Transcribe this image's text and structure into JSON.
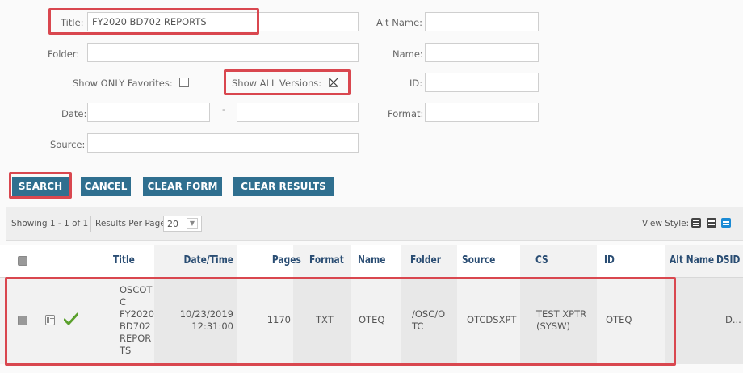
{
  "form": {
    "title_label": "Title:",
    "title_value": "FY2020 BD702 REPORTS",
    "folder_label": "Folder:",
    "folder_value": "",
    "show_favorites_label": "Show ONLY Favorites:",
    "show_all_versions_label": "Show ALL Versions:",
    "show_all_versions_checked": true,
    "date_label": "Date:",
    "date_separator": "-",
    "source_label": "Source:",
    "alt_name_label": "Alt Name:",
    "name_label": "Name:",
    "id_label": "ID:",
    "format_label": "Format:"
  },
  "buttons": {
    "search": "SEARCH",
    "cancel": "CANCEL",
    "clear_form": "CLEAR FORM",
    "clear_results": "CLEAR RESULTS"
  },
  "results_bar": {
    "showing": "Showing 1 - 1 of 1",
    "per_page_label": "Results Per Page:",
    "per_page_value": "20",
    "view_style_label": "View Style:"
  },
  "table": {
    "headers": [
      "Title",
      "Date/Time",
      "Pages",
      "Format",
      "Name",
      "Folder",
      "Source",
      "CS",
      "ID",
      "Alt Name",
      "DSID"
    ],
    "row": {
      "title": "OSCOTC FY2020 BD702 REPORTS",
      "title_lines": [
        "OSCOT",
        "C",
        "FY2020",
        "BD702",
        "REPOR",
        "TS"
      ],
      "date_lines": [
        "10/23/2019",
        "12:31:00"
      ],
      "pages": "1170",
      "format": "TXT",
      "name": "OTEQ",
      "folder_lines": [
        "/OSC/O",
        "TC"
      ],
      "source": "OTCDSXPT",
      "cs_lines": [
        "TEST XPTR",
        "(SYSW)"
      ],
      "id": "OTEQ",
      "alt_name": "",
      "dsid": "D..."
    }
  },
  "colors": {
    "button": "#2f6f8f",
    "highlight": "#d9474f",
    "header_text": "#2a4d73",
    "check": "#5aa02c"
  }
}
